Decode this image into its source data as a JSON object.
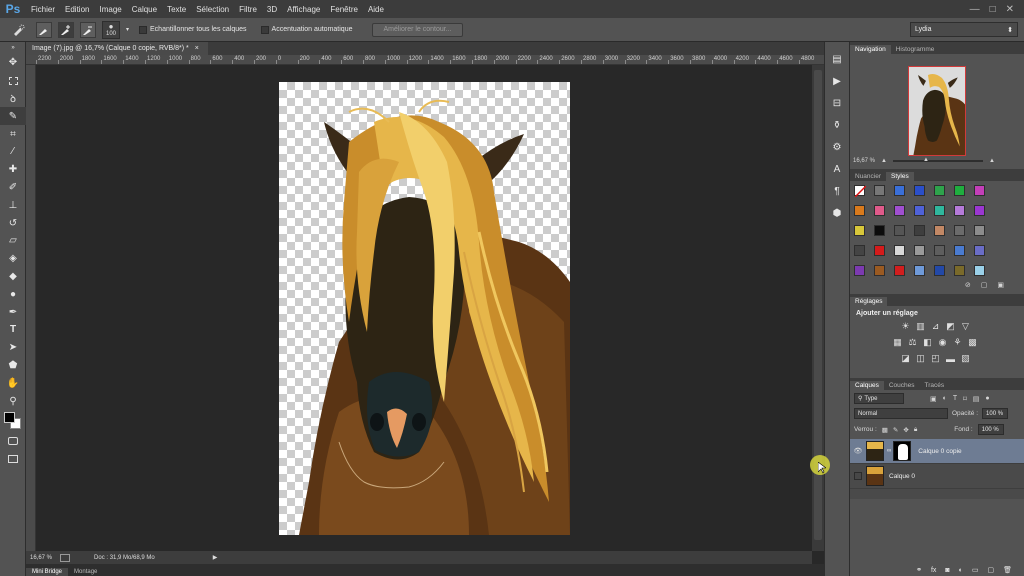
{
  "app": {
    "logo": "Ps"
  },
  "menu": [
    "Fichier",
    "Edition",
    "Image",
    "Calque",
    "Texte",
    "Sélection",
    "Filtre",
    "3D",
    "Affichage",
    "Fenêtre",
    "Aide"
  ],
  "window_controls": {
    "minimize": "—",
    "maximize": "□",
    "close": "✕"
  },
  "options": {
    "brush_size": "100",
    "sample_all_layers": "Echantillonner tous les calques",
    "auto_enhance": "Accentuation automatique",
    "refine_edge": "Améliorer le contour..."
  },
  "workspace": {
    "value": "Lydia"
  },
  "document": {
    "tab_title": "Image (7).jpg @ 16,7% (Calque 0 copie, RVB/8*) *",
    "close": "×"
  },
  "ruler_labels": [
    "2200",
    "2000",
    "1800",
    "1600",
    "1400",
    "1200",
    "1000",
    "800",
    "600",
    "400",
    "200",
    "0",
    "200",
    "400",
    "600",
    "800",
    "1000",
    "1200",
    "1400",
    "1600",
    "1800",
    "2000",
    "2200",
    "2400",
    "2600",
    "2800",
    "3000",
    "3200",
    "3400",
    "3600",
    "3800",
    "4000",
    "4200",
    "4400",
    "4600",
    "4800"
  ],
  "status": {
    "zoom": "16,67 %",
    "doc": "Doc : 31,9 Mo/68,9 Mo"
  },
  "bottom_tabs": [
    "Mini Bridge",
    "Montage"
  ],
  "navigator": {
    "tabs": [
      "Navigation",
      "Histogramme"
    ],
    "zoom": "16,67 %"
  },
  "swatches_panel": {
    "tabs": [
      "Nuancier",
      "Styles"
    ]
  },
  "adjustments": {
    "tab": "Réglages",
    "title": "Ajouter un réglage"
  },
  "layers_panel": {
    "tabs": [
      "Calques",
      "Couches",
      "Tracés"
    ],
    "filter": "Type",
    "blend_mode": "Normal",
    "opacity_label": "Opacité :",
    "opacity_value": "100 %",
    "lock_label": "Verrou :",
    "fill_label": "Fond :",
    "fill_value": "100 %",
    "layers": [
      {
        "name": "Calque 0 copie",
        "selected": true,
        "visible": true
      },
      {
        "name": "Calque 0",
        "selected": false,
        "visible": false
      }
    ],
    "footer_icons": [
      "link-icon",
      "fx-icon",
      "mask-icon",
      "adjustment-icon",
      "folder-icon",
      "new-layer-icon",
      "trash-icon"
    ]
  },
  "colors": {
    "accent_selected_layer": "#6e7c93",
    "ps_blue": "#5aa7e8",
    "foreground": "#000000",
    "background": "#ffffff"
  }
}
